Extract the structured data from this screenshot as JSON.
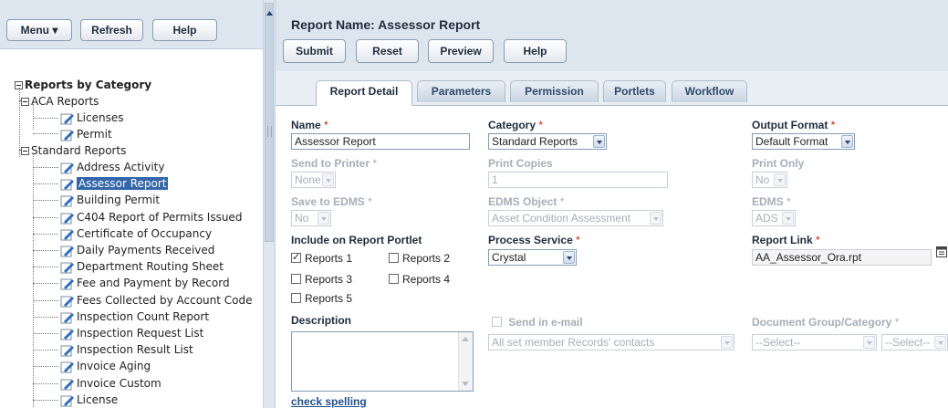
{
  "left_toolbar": {
    "menu_label": "Menu ▾",
    "refresh_label": "Refresh",
    "help_label": "Help"
  },
  "tree": {
    "root_label": "Reports by Category",
    "groups": [
      {
        "label": "ACA Reports",
        "items": [
          "Licenses",
          "Permit"
        ]
      },
      {
        "label": "Standard Reports",
        "items": [
          "Address Activity",
          "Assessor Report",
          "Building Permit",
          "C404 Report of Permits Issued",
          "Certificate of Occupancy",
          "Daily Payments Received",
          "Department Routing Sheet",
          "Fee and Payment by Record",
          "Fees Collected by Account Code",
          "Inspection Count Report",
          "Inspection Request List",
          "Inspection Result List",
          "Invoice Aging",
          "Invoice Custom",
          "License"
        ]
      }
    ],
    "selected": "Assessor Report"
  },
  "header": {
    "report_name": "Report Name: Assessor Report",
    "submit_label": "Submit",
    "reset_label": "Reset",
    "preview_label": "Preview",
    "help_label": "Help"
  },
  "tabs": [
    "Report Detail",
    "Parameters",
    "Permission",
    "Portlets",
    "Workflow"
  ],
  "form": {
    "name_label": "Name",
    "name_value": "Assessor Report",
    "category_label": "Category",
    "category_value": "Standard Reports",
    "output_format_label": "Output Format",
    "output_format_value": "Default Format",
    "send_to_printer_label": "Send to Printer",
    "send_to_printer_value": "None",
    "print_copies_label": "Print Copies",
    "print_copies_value": "1",
    "print_only_label": "Print Only",
    "print_only_value": "No",
    "save_edms_label": "Save to EDMS",
    "save_edms_value": "No",
    "edms_object_label": "EDMS Object",
    "edms_object_value": "Asset Condition Assessment",
    "edms_label": "EDMS",
    "edms_value": "ADS",
    "include_portlet_label": "Include on Report Portlet",
    "portlets": [
      {
        "label": "Reports 1",
        "checked": true
      },
      {
        "label": "Reports 2",
        "checked": false
      },
      {
        "label": "Reports 3",
        "checked": false
      },
      {
        "label": "Reports 4",
        "checked": false
      },
      {
        "label": "Reports 5",
        "checked": false
      }
    ],
    "process_service_label": "Process Service",
    "process_service_value": "Crystal",
    "report_link_label": "Report Link",
    "report_link_value": "AA_Assessor_Ora.rpt",
    "description_label": "Description",
    "description_value": "",
    "send_email_label": "Send in e-mail",
    "send_email_select": "All set member Records' contacts",
    "doc_group_label": "Document Group/Category",
    "doc_group_select1": "--Select--",
    "doc_group_select2": "--Select--",
    "check_spelling": "check spelling",
    "required_mark": "*"
  },
  "colors": {
    "toolbar_bg": "#dde6ef",
    "selected_bg": "#3366aa",
    "required": "#cc2200"
  }
}
